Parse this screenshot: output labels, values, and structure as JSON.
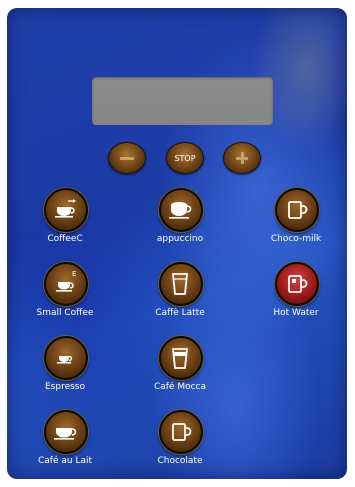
{
  "display": {
    "text": ""
  },
  "controls": {
    "minus": {
      "icon": "minus-icon"
    },
    "stop": {
      "label": "STOP"
    },
    "plus": {
      "icon": "plus-icon"
    }
  },
  "beverages": {
    "coffee_c": {
      "label": "CoffeeC",
      "icon": "cup-arrow-icon"
    },
    "cappuccino": {
      "label": "appuccino",
      "icon": "cappuccino-cup-icon"
    },
    "choco_milk": {
      "label": "Choco-milk",
      "icon": "mug-icon"
    },
    "small_coffee": {
      "label": "Small Coffee",
      "badge": "E",
      "icon": "small-cup-icon"
    },
    "caffe_latte": {
      "label": "Caffè Latte",
      "icon": "tall-glass-icon"
    },
    "hot_water": {
      "label": "Hot Water",
      "icon": "hot-water-mug-icon"
    },
    "espresso": {
      "label": "Espresso",
      "icon": "espresso-cup-icon"
    },
    "cafe_mocca": {
      "label": "Café Mocca",
      "icon": "mocca-glass-icon"
    },
    "cafe_au_lait": {
      "label": "Café au Lait",
      "icon": "cup-icon"
    },
    "chocolate": {
      "label": "Chocolate",
      "icon": "chocolate-mug-icon"
    }
  },
  "colors": {
    "panel": "#1f3faa",
    "button_brown": "#6a3f15",
    "button_red": "#a31c1c",
    "display_gray": "#8a8a8a",
    "label_white": "#ffffff"
  }
}
